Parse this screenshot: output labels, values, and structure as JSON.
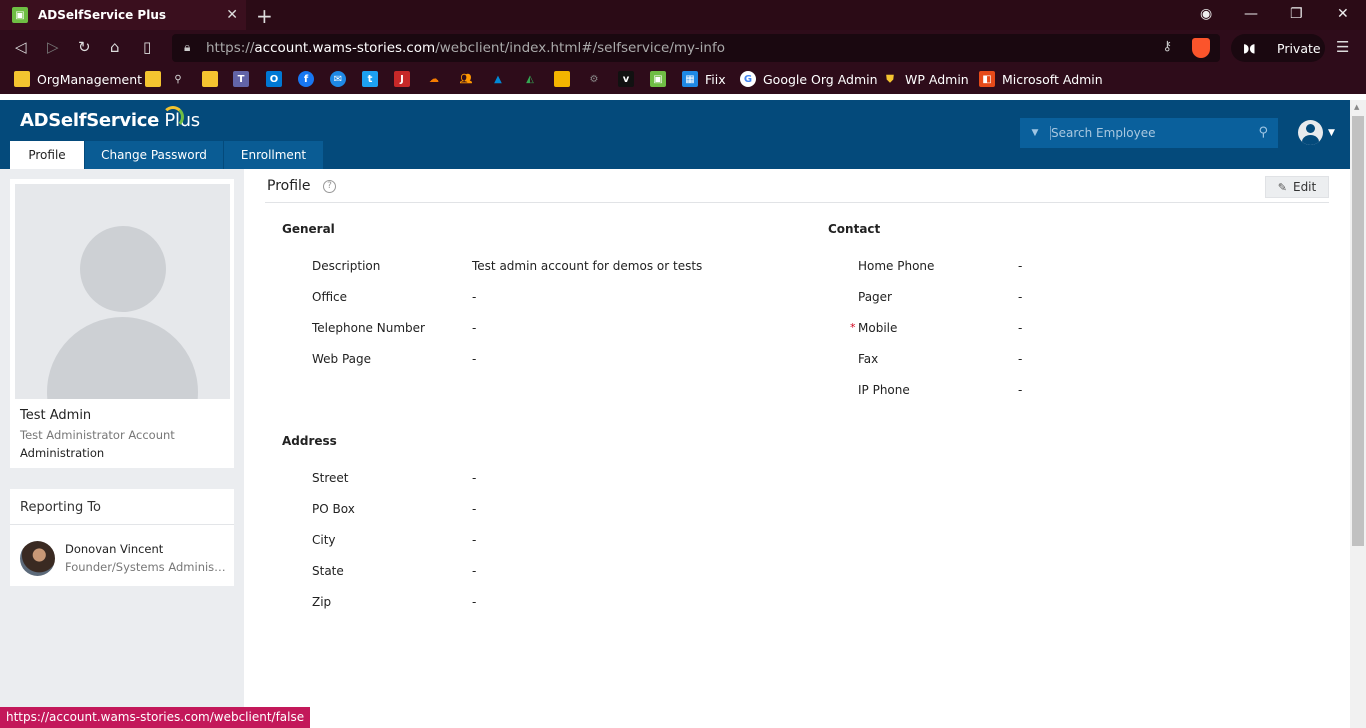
{
  "browser": {
    "tab_title": "ADSelfService Plus",
    "url_prefix": "https://",
    "url_host": "account.wams-stories.com",
    "url_path": "/webclient/index.html#/selfservice/my-info",
    "private_label": "Private",
    "status_url": "https://account.wams-stories.com/webclient/false"
  },
  "bookmarks": [
    {
      "label": "OrgManagement",
      "icon": "folder-icon",
      "color": "#f4c430"
    },
    {
      "label": "Fiix",
      "icon": "fiix-icon",
      "color": "#1e88e5"
    },
    {
      "label": "Google Org Admin",
      "icon": "google-icon",
      "color": "#ffffff"
    },
    {
      "label": "WP Admin",
      "icon": "wp-shield-icon",
      "color": "#f4c430"
    },
    {
      "label": "Microsoft Admin",
      "icon": "office-icon",
      "color": "#e64a19"
    }
  ],
  "app": {
    "logo_text": "ADSelfService",
    "logo_plus": " Plus",
    "tabs": [
      "Profile",
      "Change Password",
      "Enrollment"
    ],
    "search_placeholder": "Search Employee"
  },
  "profile": {
    "name": "Test Admin",
    "title": "Test Administrator Account",
    "department": "Administration"
  },
  "reporting": {
    "heading": "Reporting To",
    "name": "Donovan Vincent",
    "role": "Founder/Systems Administrator"
  },
  "main": {
    "title": "Profile",
    "edit_label": "Edit",
    "general": {
      "heading": "General",
      "fields": [
        {
          "label": "Description",
          "value": "Test admin account for demos or tests"
        },
        {
          "label": "Office",
          "value": "-"
        },
        {
          "label": "Telephone Number",
          "value": "-"
        },
        {
          "label": "Web Page",
          "value": "-"
        }
      ]
    },
    "contact": {
      "heading": "Contact",
      "fields": [
        {
          "label": "Home Phone",
          "value": "-"
        },
        {
          "label": "Pager",
          "value": "-"
        },
        {
          "label": "Mobile",
          "value": "-",
          "required": "*"
        },
        {
          "label": "Fax",
          "value": "-"
        },
        {
          "label": "IP Phone",
          "value": "-"
        }
      ]
    },
    "address": {
      "heading": "Address",
      "fields": [
        {
          "label": "Street",
          "value": "-"
        },
        {
          "label": "PO Box",
          "value": "-"
        },
        {
          "label": "City",
          "value": "-"
        },
        {
          "label": "State",
          "value": "-"
        },
        {
          "label": "Zip",
          "value": "-"
        }
      ]
    }
  },
  "colors": {
    "header_bg": "#044a7b",
    "browser_bg": "#2e0c1a",
    "status_bar": "#c3185a"
  }
}
